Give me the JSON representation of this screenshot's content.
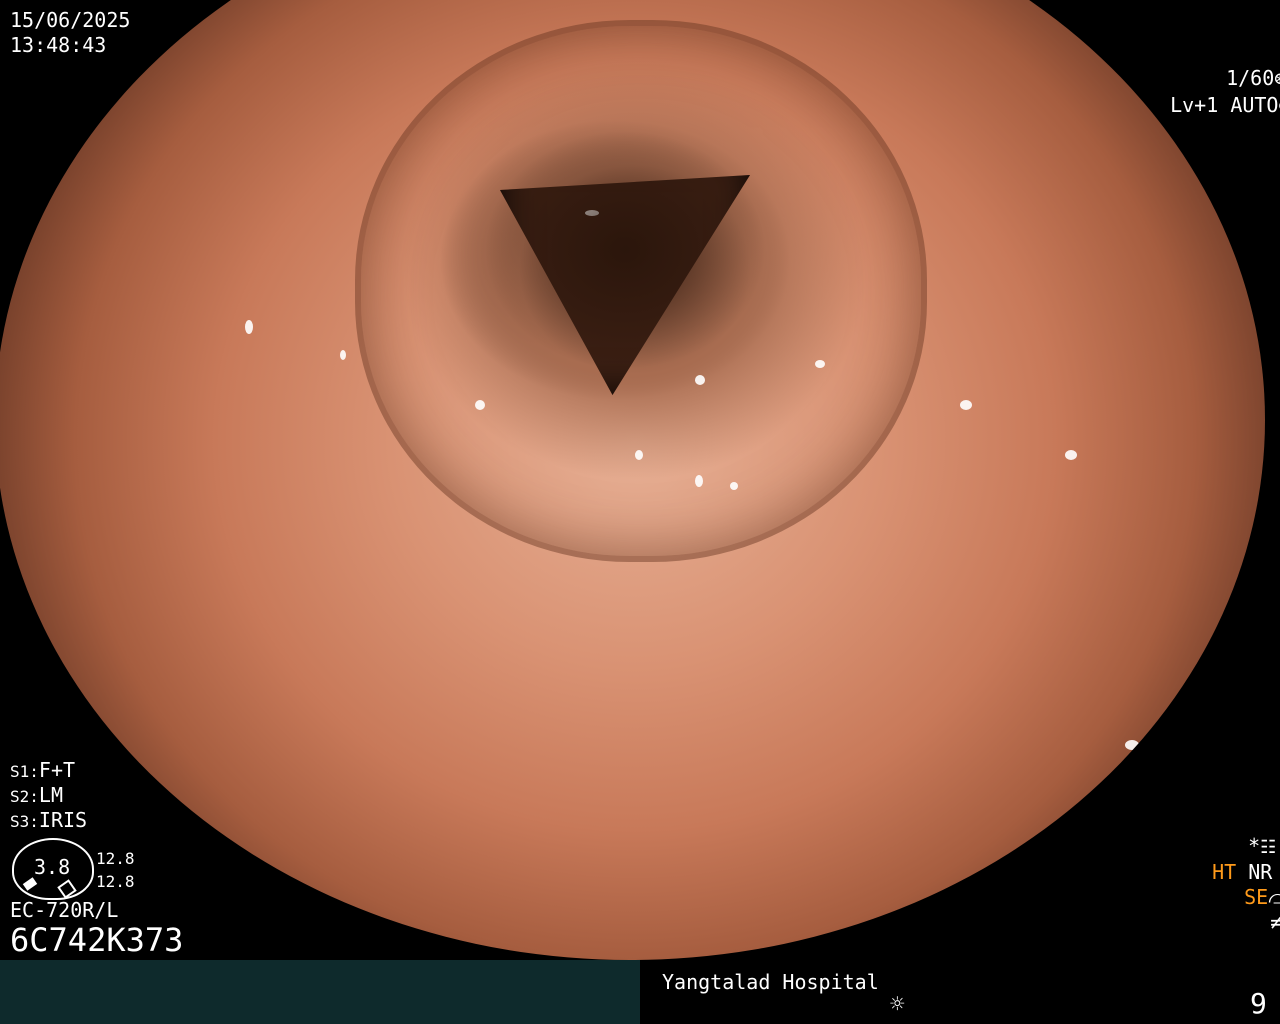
{
  "osd": {
    "date": "15/06/2025",
    "time": "13:48:43",
    "shutter": "1/60",
    "level": "Lv+1",
    "exposure_mode": "AUTO",
    "settings": [
      "F+T",
      "LM",
      "IRIS"
    ],
    "setting_keys": [
      "S1",
      "S2",
      "S3"
    ],
    "dial_value": "3.8",
    "scale_top": "12.8",
    "scale_bottom": "12.8",
    "model": "EC-720R/L",
    "serial": "6C742K373",
    "mode_star": "*",
    "ht": "HT",
    "nr": "NR",
    "se": "SE",
    "hospital": "Yangtalad Hospital",
    "frame_number": "9"
  },
  "icons": {
    "shutter_icon": "aperture-icon",
    "auto_icon": "iris-icon",
    "menu_icon": "settings-panel-icon",
    "se_icon": "curve-icon",
    "f_icon": "function-icon",
    "light_icon": "sun-icon"
  },
  "colors": {
    "orange_label": "#ff9a1a",
    "bottom_bar": "#0e2a2c"
  }
}
